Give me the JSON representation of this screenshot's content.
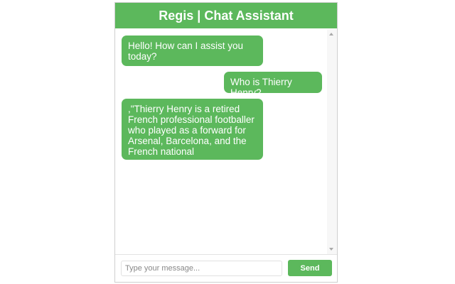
{
  "header": {
    "title": "Regis | Chat Assistant"
  },
  "messages": [
    {
      "sender": "assistant",
      "text": "Hello! How can I assist you today?"
    },
    {
      "sender": "user",
      "text": "Who is Thierry Henry?"
    },
    {
      "sender": "assistant",
      "text": ",\"Thierry Henry is a retired French professional footballer who played as a forward for Arsenal, Barcelona, and the French national"
    }
  ],
  "composer": {
    "placeholder": "Type your message...",
    "value": "",
    "send_label": "Send"
  },
  "colors": {
    "accent": "#5cb85c",
    "bubble_text": "#ffffff"
  }
}
